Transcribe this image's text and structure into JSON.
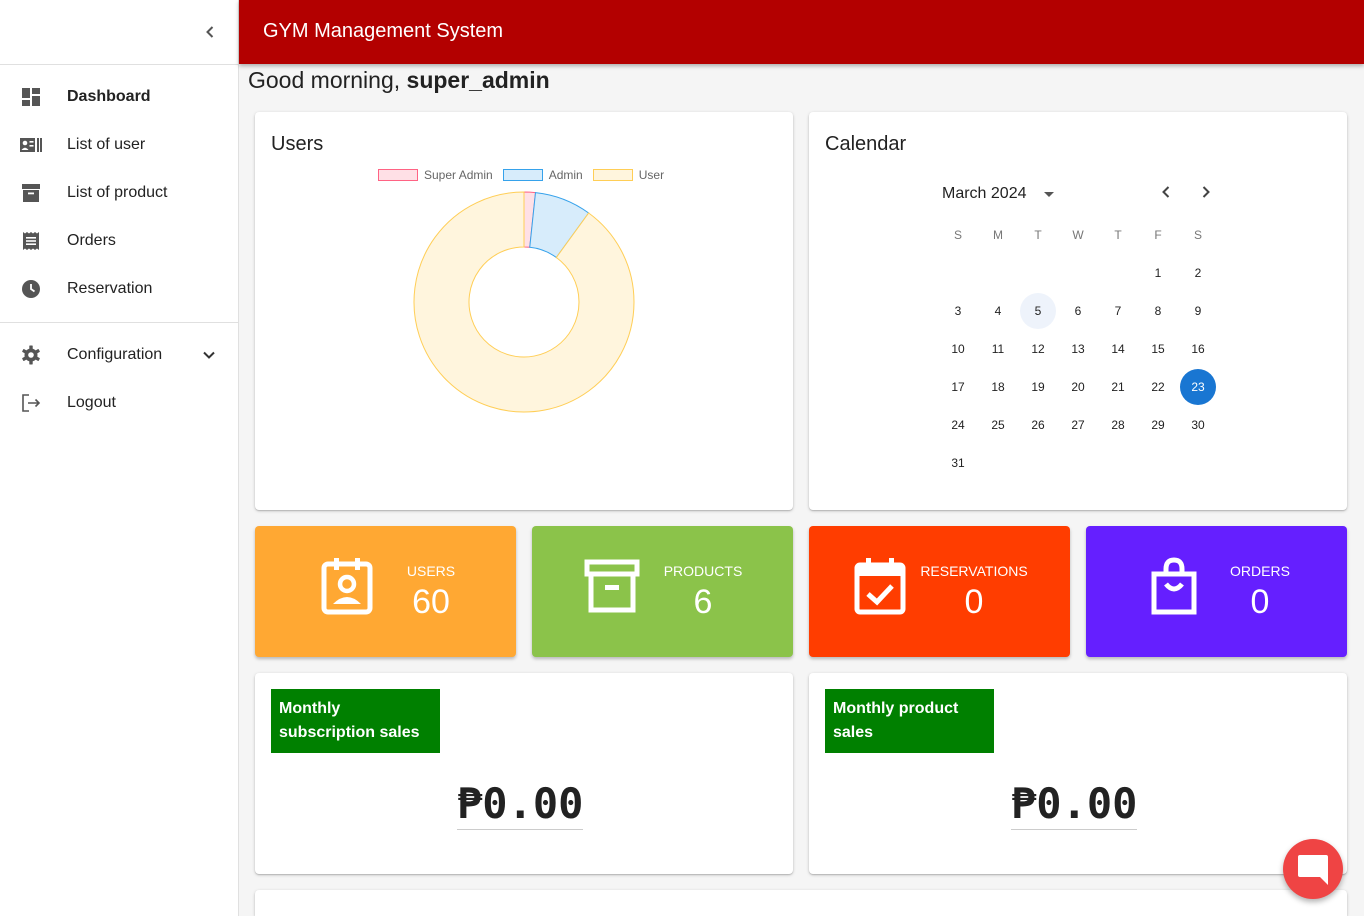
{
  "header": {
    "title": "GYM Management System"
  },
  "greeting": {
    "prefix": "Good morning, ",
    "username": "super_admin"
  },
  "sidebar": {
    "items": [
      {
        "label": "Dashboard",
        "icon": "dashboard-icon",
        "active": true
      },
      {
        "label": "List of user",
        "icon": "badge-icon"
      },
      {
        "label": "List of product",
        "icon": "archive-icon"
      },
      {
        "label": "Orders",
        "icon": "receipt-icon"
      },
      {
        "label": "Reservation",
        "icon": "clock-icon"
      }
    ],
    "config_label": "Configuration",
    "logout_label": "Logout"
  },
  "users_card": {
    "title": "Users",
    "legend": [
      "Super Admin",
      "Admin",
      "User"
    ]
  },
  "chart_data": {
    "type": "pie",
    "variant": "doughnut",
    "categories": [
      "Super Admin",
      "Admin",
      "User"
    ],
    "values": [
      1,
      5,
      54
    ],
    "colors": {
      "Super Admin": "#ffe0e6",
      "Admin": "#d7ecfb",
      "User": "#fff5dd"
    },
    "borders": {
      "Super Admin": "#ff6384",
      "Admin": "#36a2eb",
      "User": "#ffce56"
    },
    "legend": "top"
  },
  "calendar": {
    "title": "Calendar",
    "month_label": "March 2024",
    "weekdays": [
      "S",
      "M",
      "T",
      "W",
      "T",
      "F",
      "S"
    ],
    "weeks": [
      [
        "",
        "",
        "",
        "",
        "",
        "1",
        "2"
      ],
      [
        "3",
        "4",
        "5",
        "6",
        "7",
        "8",
        "9"
      ],
      [
        "10",
        "11",
        "12",
        "13",
        "14",
        "15",
        "16"
      ],
      [
        "17",
        "18",
        "19",
        "20",
        "21",
        "22",
        "23"
      ],
      [
        "24",
        "25",
        "26",
        "27",
        "28",
        "29",
        "30"
      ],
      [
        "31",
        "",
        "",
        "",
        "",
        "",
        ""
      ]
    ],
    "today": "5",
    "selected": "23",
    "accent": "#1976d2"
  },
  "stats": [
    {
      "label": "USERS",
      "value": "60",
      "color": "#ffa833",
      "icon": "contact-calendar-icon"
    },
    {
      "label": "PRODUCTS",
      "value": "6",
      "color": "#8bc34a",
      "icon": "archive-box-icon"
    },
    {
      "label": "RESERVATIONS",
      "value": "0",
      "color": "#ff3d00",
      "icon": "calendar-check-icon"
    },
    {
      "label": "ORDERS",
      "value": "0",
      "color": "#651fff",
      "icon": "shopping-bag-icon"
    }
  ],
  "sales": [
    {
      "title": "Monthly subscription sales",
      "value": "₱0.00"
    },
    {
      "title": "Monthly product sales",
      "value": "₱0.00"
    }
  ],
  "colors": {
    "topbar": "#b30000",
    "badge": "#008000",
    "chat": "#ef4444"
  }
}
